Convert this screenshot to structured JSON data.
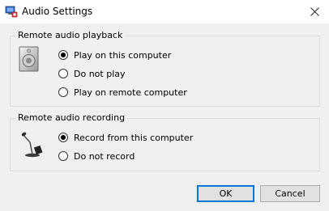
{
  "window": {
    "title": "Audio Settings"
  },
  "icons": {
    "app": "audio-settings-app-icon",
    "close": "close-icon",
    "speaker": "speaker-icon",
    "microphone": "microphone-icon"
  },
  "playback": {
    "label": "Remote audio playback",
    "options": [
      {
        "label": "Play on this computer",
        "selected": true
      },
      {
        "label": "Do not play",
        "selected": false
      },
      {
        "label": "Play on remote computer",
        "selected": false
      }
    ]
  },
  "recording": {
    "label": "Remote audio recording",
    "options": [
      {
        "label": "Record from this computer",
        "selected": true
      },
      {
        "label": "Do not record",
        "selected": false
      }
    ]
  },
  "buttons": {
    "ok": "OK",
    "cancel": "Cancel"
  },
  "colors": {
    "accent": "#0078d7",
    "background": "#f0f0f0"
  }
}
